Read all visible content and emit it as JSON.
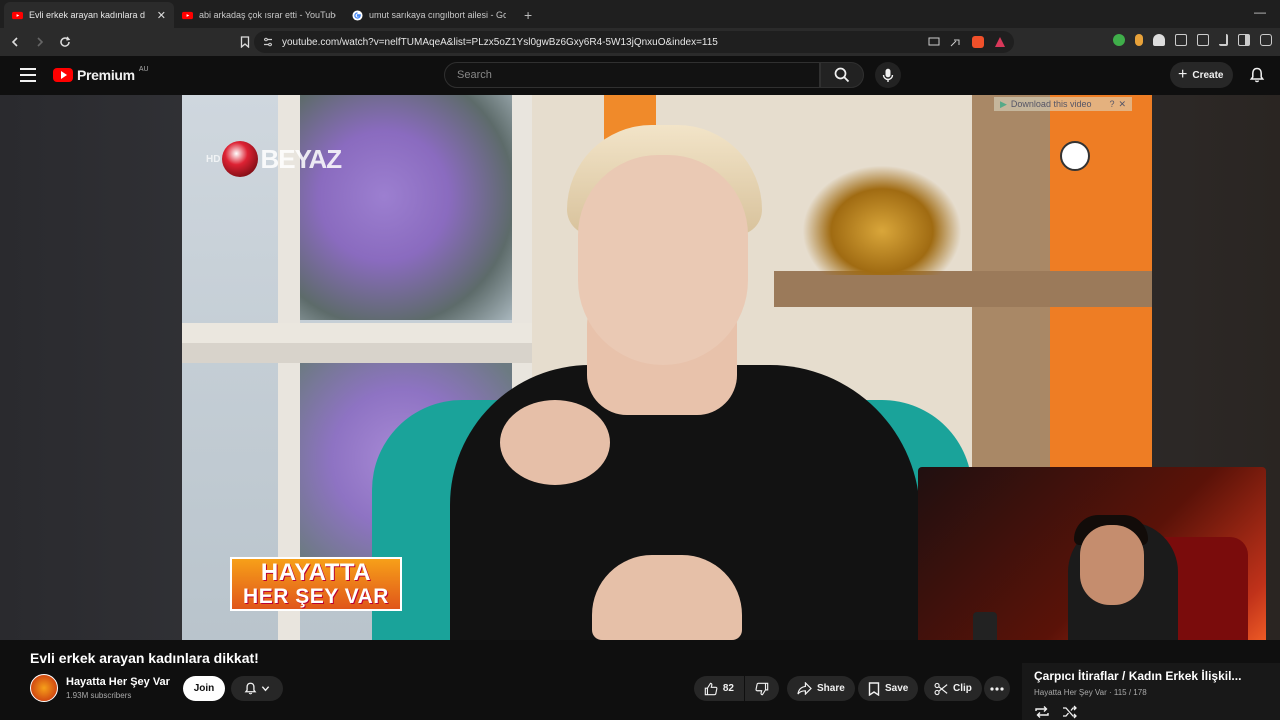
{
  "browser": {
    "tabs": [
      {
        "title": "Evli erkek arayan kadınlara dikkat",
        "active": true,
        "favicon": "youtube-icon"
      },
      {
        "title": "abi arkadaş çok ısrar etti - YouTube",
        "active": false,
        "favicon": "youtube-icon"
      },
      {
        "title": "umut sarıkaya cıngılbort ailesi - Goog",
        "active": false,
        "favicon": "google-icon"
      }
    ],
    "new_tab": "+",
    "url": "youtube.com/watch?v=nelfTUMAqeA&list=PLzx5oZ1Ysl0gwBz6Gxy6R4-5W13jQnxuO&index=115"
  },
  "youtube": {
    "logo_text": "Premium",
    "region": "AU",
    "search_placeholder": "Search",
    "create_label": "Create"
  },
  "video": {
    "channel_watermark": "BEYAZ",
    "watermark_hd": "HD",
    "show_logo_line1": "HAYATTA",
    "show_logo_line2": "HER ŞEY VAR",
    "download_banner": "Download this video"
  },
  "info": {
    "title": "Evli erkek arayan kadınlara dikkat!",
    "channel_name": "Hayatta Her Şey Var",
    "subscribers": "1.93M subscribers",
    "join_label": "Join",
    "like_count": "82",
    "share_label": "Share",
    "save_label": "Save",
    "clip_label": "Clip"
  },
  "playlist": {
    "title": "Çarpıcı İtiraflar / Kadın Erkek İlişkil...",
    "meta": "Hayatta Her Şey Var · 115 / 178"
  },
  "colors": {
    "yt_red": "#ff0000",
    "bg": "#0f0f0f",
    "pill": "#272727"
  }
}
